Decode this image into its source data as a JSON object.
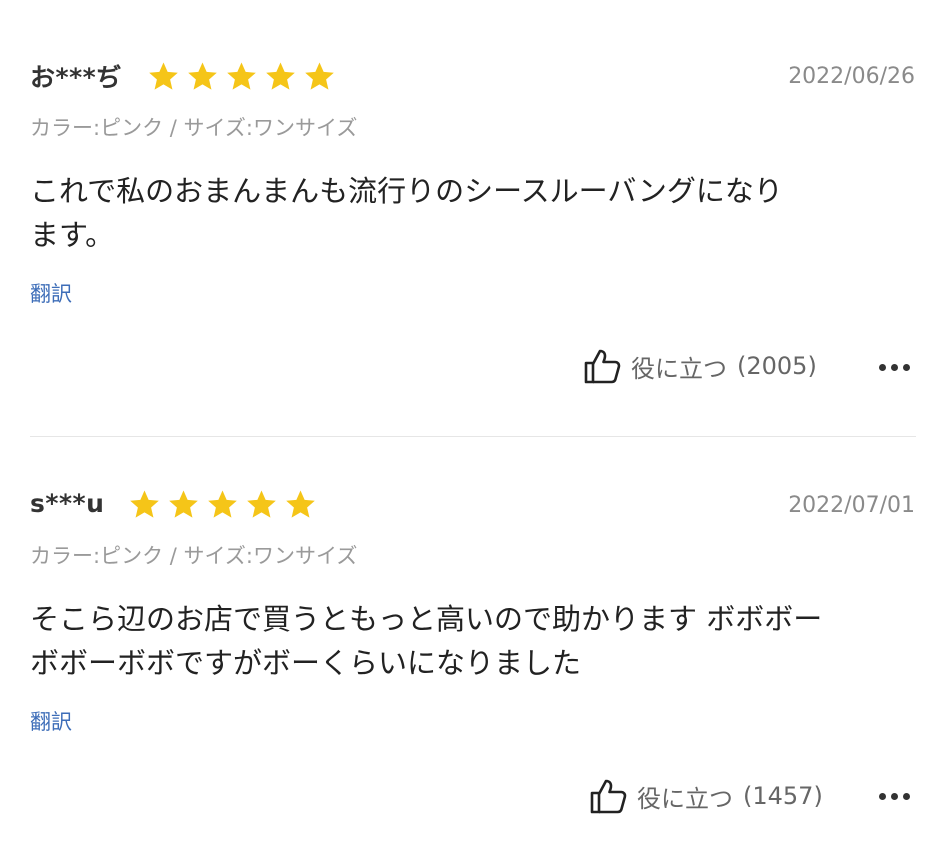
{
  "colors": {
    "star": "#f5c518",
    "link": "#3d6db8",
    "muted": "#8a8a8a"
  },
  "icons": {
    "rating": "star-icon",
    "helpful": "thumbs-up-icon",
    "more": "more-options-icon"
  },
  "reviews": [
    {
      "username": "お***ぢ",
      "rating": 5,
      "date": "2022/06/26",
      "variant": "カラー:ピンク / サイズ:ワンサイズ",
      "text_line1": "これで私のおまんまんも流行りのシースルーバングになり",
      "text_line2": "ます。",
      "translate_label": "翻訳",
      "helpful_label": "役に立つ",
      "helpful_count": "(2005)"
    },
    {
      "username": "s***u",
      "rating": 5,
      "date": "2022/07/01",
      "variant": "カラー:ピンク / サイズ:ワンサイズ",
      "text_line1": "そこら辺のお店で買うともっと高いので助かります ボボボー",
      "text_line2": "ボボーボボですがボーくらいになりました",
      "translate_label": "翻訳",
      "helpful_label": "役に立つ",
      "helpful_count": "(1457)"
    }
  ]
}
